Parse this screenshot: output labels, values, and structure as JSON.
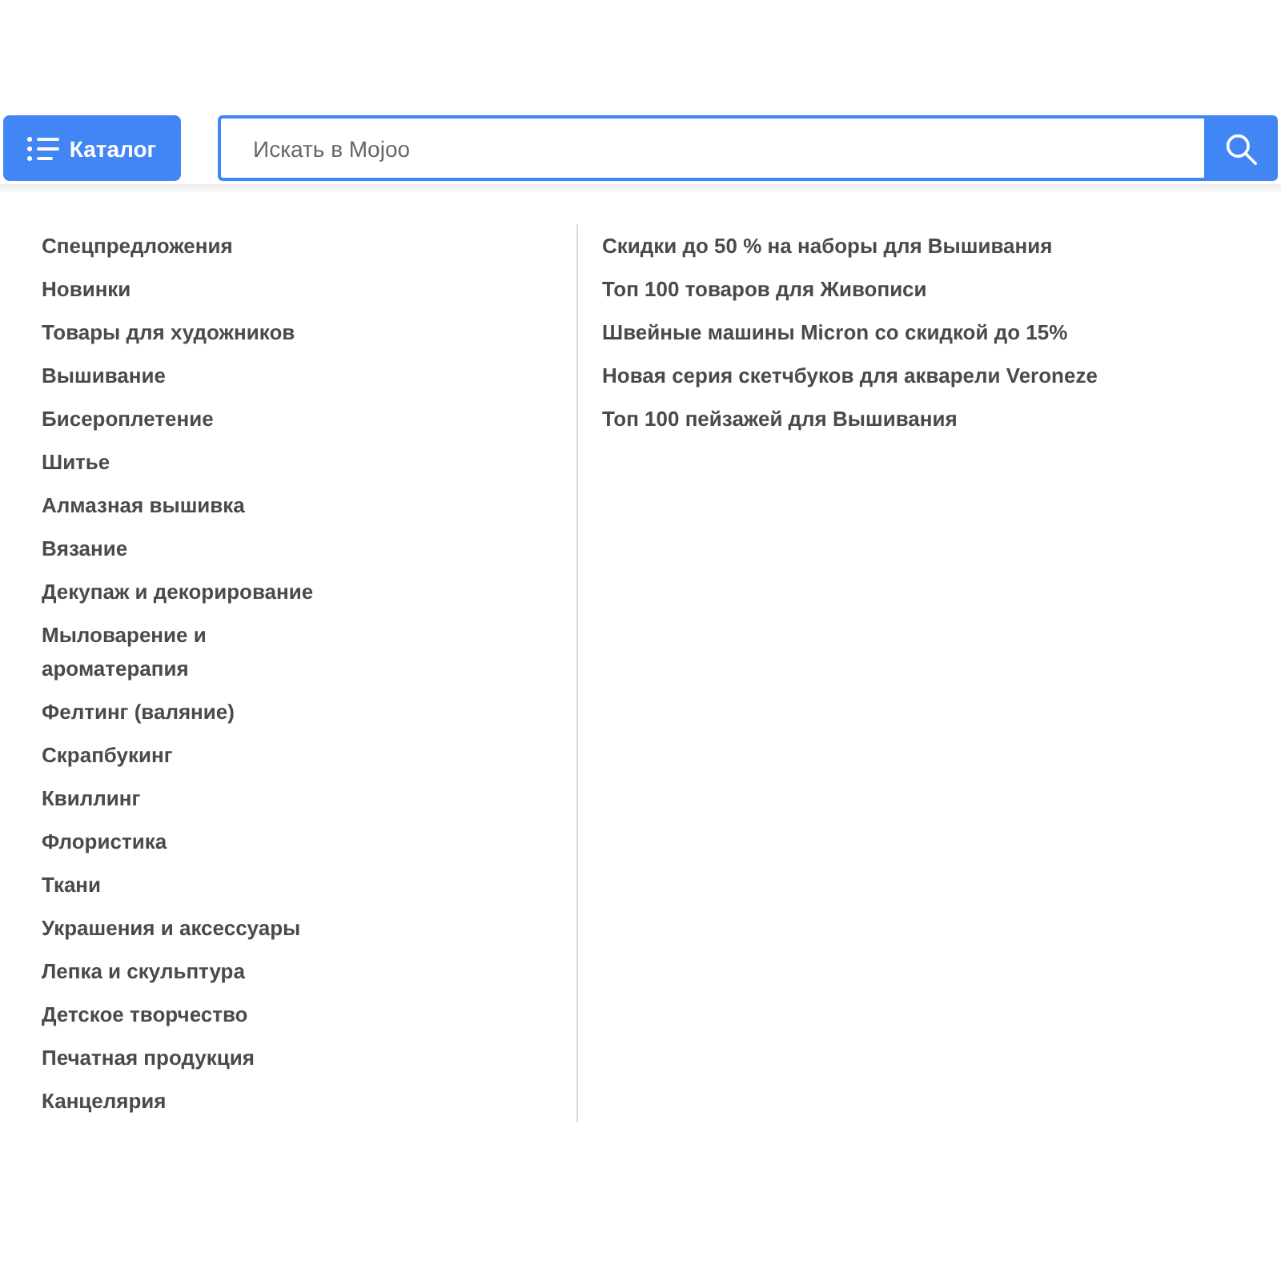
{
  "header": {
    "catalog_button": {
      "label": "Каталог"
    },
    "search": {
      "placeholder": "Искать в Mojoo"
    }
  },
  "categories": [
    "Спецпредложения",
    "Новинки",
    "Товары для художников",
    "Вышивание",
    "Бисероплетение",
    "Шитье",
    "Алмазная вышивка",
    "Вязание",
    "Декупаж и декорирование",
    "Мыловарение и ароматерапия",
    "Фелтинг (валяние)",
    "Скрапбукинг",
    "Квиллинг",
    "Флористика",
    "Ткани",
    "Украшения и аксессуары",
    "Лепка и скульптура",
    "Детское творчество",
    "Печатная продукция",
    "Канцелярия"
  ],
  "promotions": [
    "Скидки до 50 % на наборы для Вышивания",
    "Топ 100 товаров для Живописи",
    "Швейные машины Micron со скидкой до 15%",
    "Новая серия скетчбуков для акварели Veroneze",
    "Топ 100 пейзажей для Вышивания"
  ]
}
